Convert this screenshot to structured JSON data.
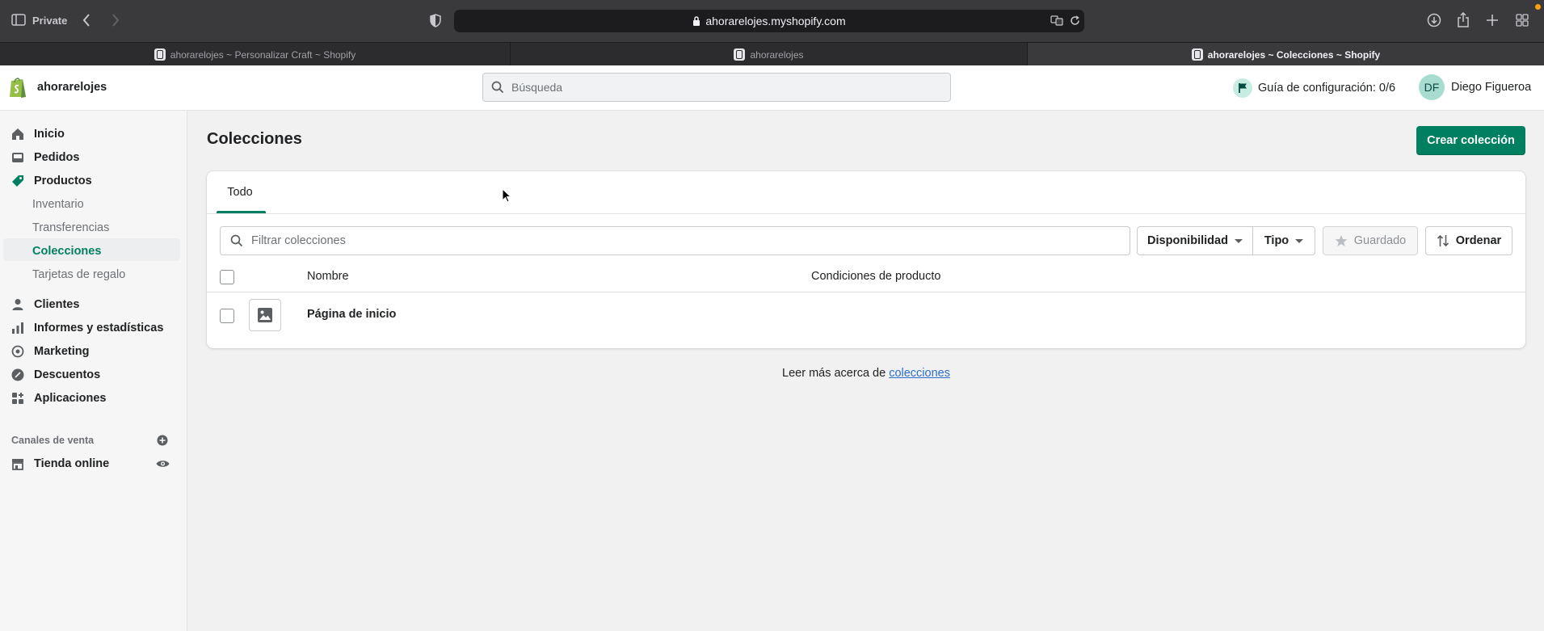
{
  "browser": {
    "mode_label": "Private",
    "url": "ahorarelojes.myshopify.com",
    "tabs": [
      {
        "title": "ahorarelojes ~ Personalizar Craft ~ Shopify"
      },
      {
        "title": "ahorarelojes"
      },
      {
        "title": "ahorarelojes ~ Colecciones ~ Shopify"
      }
    ]
  },
  "topbar": {
    "store_name": "ahorarelojes",
    "search_placeholder": "Búsqueda",
    "setup_guide": "Guía de configuración: 0/6",
    "user_initials": "DF",
    "user_name": "Diego Figueroa"
  },
  "sidebar": {
    "items": [
      {
        "label": "Inicio",
        "icon": "home-icon"
      },
      {
        "label": "Pedidos",
        "icon": "orders-icon"
      },
      {
        "label": "Productos",
        "icon": "tag-icon"
      }
    ],
    "product_sub": [
      "Inventario",
      "Transferencias",
      "Colecciones",
      "Tarjetas de regalo"
    ],
    "items2": [
      {
        "label": "Clientes",
        "icon": "person-icon"
      },
      {
        "label": "Informes y estadísticas",
        "icon": "analytics-icon"
      },
      {
        "label": "Marketing",
        "icon": "marketing-icon"
      },
      {
        "label": "Descuentos",
        "icon": "discount-icon"
      },
      {
        "label": "Aplicaciones",
        "icon": "apps-icon"
      }
    ],
    "channels_heading": "Canales de venta",
    "online_store": "Tienda online"
  },
  "main": {
    "title": "Colecciones",
    "create_button": "Crear colección",
    "tab_all": "Todo",
    "filter_placeholder": "Filtrar colecciones",
    "availability_button": "Disponibilidad",
    "type_button": "Tipo",
    "saved_button": "Guardado",
    "sort_button": "Ordenar",
    "columns": [
      "Nombre",
      "Condiciones de producto"
    ],
    "rows": [
      {
        "name": "Página de inicio",
        "conditions": ""
      }
    ],
    "learn_prefix": "Leer más acerca de ",
    "learn_link": "colecciones"
  },
  "colors": {
    "primary": "#008060",
    "link": "#2c6ecb"
  }
}
